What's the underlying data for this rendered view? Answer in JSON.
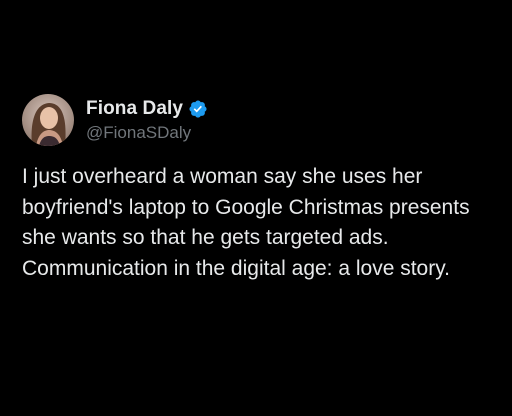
{
  "author": {
    "display_name": "Fiona Daly",
    "handle": "@FionaSDaly",
    "verified_icon": "verified-badge-icon",
    "verified_color": "#1d9bf0"
  },
  "tweet": {
    "text": "I just overheard a woman say she uses her boyfriend's laptop to Google Christmas presents she wants so that he gets targeted ads. Communication in the digital age: a love story."
  },
  "colors": {
    "background": "#000000",
    "primary_text": "#e7e9ea",
    "secondary_text": "#71767b"
  }
}
